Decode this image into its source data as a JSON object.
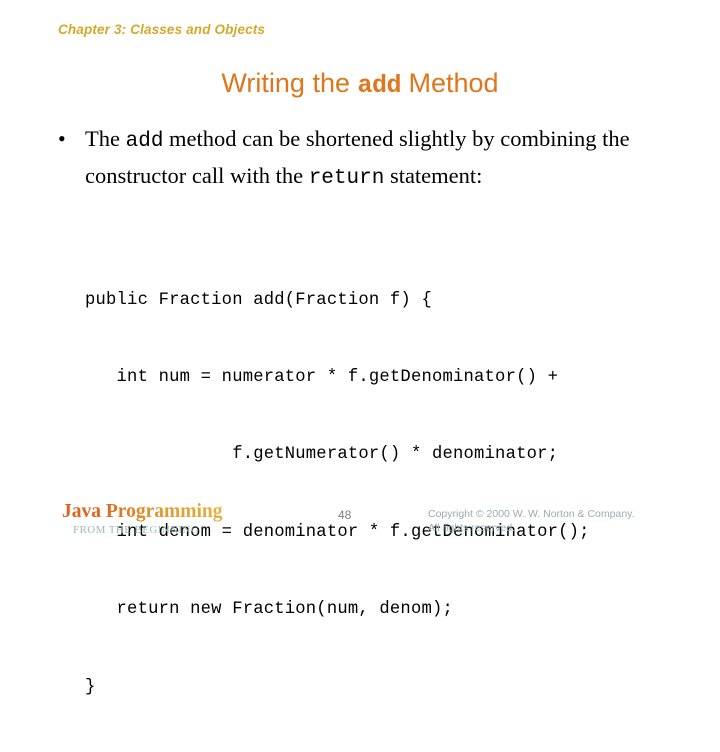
{
  "slide": {
    "chapter_header": "Chapter 3: Classes and Objects",
    "title": {
      "part1": "Writing the ",
      "mono": "add",
      "part2": " Method"
    },
    "bullet": {
      "marker": "•",
      "seg1": "The ",
      "mono1": "add",
      "seg2": " method can be shortened slightly by combining the constructor call with the ",
      "mono2": "return",
      "seg3": " statement:"
    },
    "code": {
      "lines": [
        "public Fraction add(Fraction f) {",
        "   int num = numerator * f.getDenominator() +",
        "              f.getNumerator() * denominator;",
        "   int denom = denominator * f.getDenominator();",
        "   return new Fraction(num, denom);",
        "}"
      ]
    },
    "footer": {
      "logo_main": "Java Programming",
      "logo_sub": "FROM THE BEGINNING",
      "page_number": "48",
      "copyright_line1": "Copyright © 2000 W. W. Norton & Company.",
      "copyright_line2": "All rights reserved."
    },
    "colors": {
      "chapter_header": "#D6A728",
      "title": "#E0761B",
      "logo_start": "#E2621C",
      "logo_end": "#E3B342",
      "logo_sub": "#9FB7BE",
      "copyright": "#9AACB2",
      "body_text": "#000000",
      "background": "#FFFFFF"
    }
  }
}
